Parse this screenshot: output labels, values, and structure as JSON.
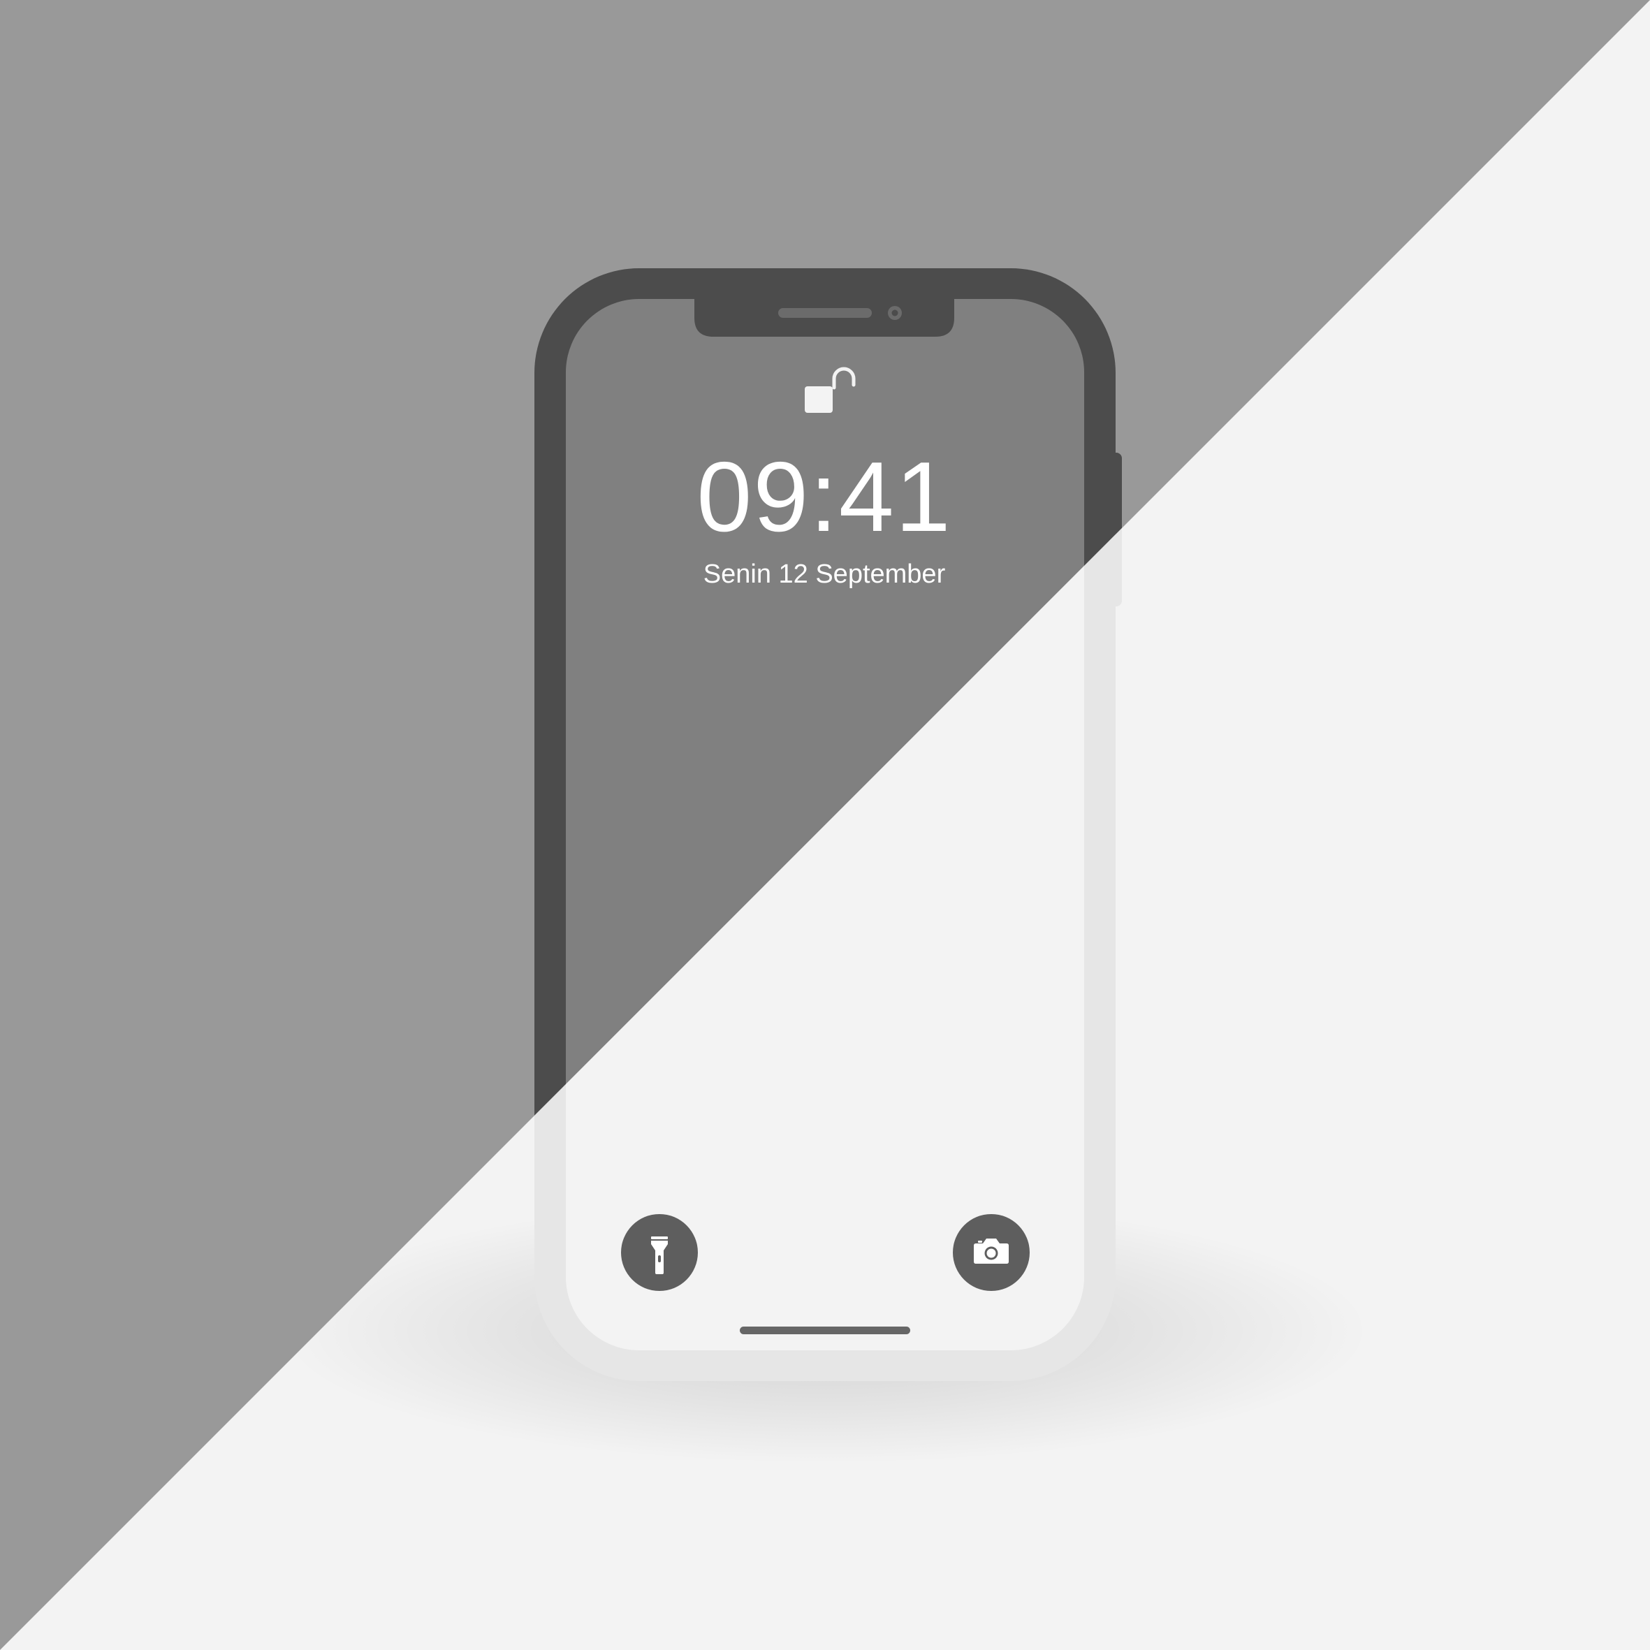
{
  "lock_screen": {
    "time": "09:41",
    "date": "Senin 12 September",
    "lock_state_icon": "unlocked-padlock-icon"
  },
  "quick_actions": {
    "left_icon": "flashlight-icon",
    "right_icon": "camera-icon"
  },
  "colors": {
    "background_dark": "#999999",
    "background_light": "#f3f3f3",
    "phone_frame_dark": "#4c4c4c",
    "phone_frame_light": "#e6e6e6",
    "screen_dark": "#808080",
    "screen_light": "#f3f3f3",
    "button_fill": "#5e5e5e",
    "home_indicator": "#666666",
    "text": "#ffffff"
  }
}
